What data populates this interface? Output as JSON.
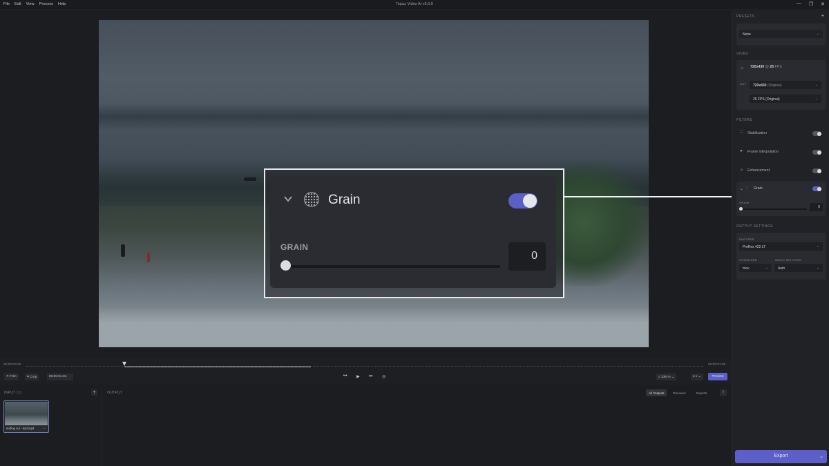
{
  "menu": [
    "File",
    "Edit",
    "View",
    "Process",
    "Help"
  ],
  "app_title": "Topaz Video AI  v3.0.0",
  "window_controls": {
    "minimize": "—",
    "maximize": "❐",
    "close": "✕"
  },
  "zoom_callout": {
    "title": "Grain",
    "enabled": true,
    "param_label": "GRAIN",
    "value": "0"
  },
  "timeline": {
    "start_time": "00:00:00:00",
    "end_time": "00:00:07:06",
    "trim_label": "Trim",
    "crop_label": "Crop",
    "current_time": "00:00:01:01",
    "zoom_value": "236 %",
    "speed_value": "2 x",
    "preview_label": "Preview"
  },
  "input_pane": {
    "title": "INPUT (1)",
    "add_label": "+",
    "files": [
      {
        "name": "surfing cut - dad.mp4",
        "more": "..."
      }
    ]
  },
  "output_pane": {
    "title": "OUTPUT",
    "tabs": [
      "All Outputs",
      "Previews",
      "Exports"
    ],
    "active_tab": "All Outputs"
  },
  "sidebar": {
    "presets": {
      "title": "PRESETS",
      "add_label": "+",
      "value": "None"
    },
    "video": {
      "title": "VIDEO",
      "in_label": "IN",
      "in_resolution": "720x430",
      "in_at": "@",
      "in_fps": "25",
      "in_fps_unit": "FPS",
      "out_label": "OUT",
      "out_resolution": "720x430",
      "out_resolution_note": "(Original)",
      "out_fps": "25 FPS (Original)"
    },
    "filters": {
      "title": "FILTERS",
      "items": [
        {
          "label": "Stabilization",
          "enabled": false
        },
        {
          "label": "Frame Interpolation",
          "enabled": false
        },
        {
          "label": "Enhancement",
          "enabled": false
        },
        {
          "label": "Grain",
          "enabled": true
        }
      ],
      "grain_param_label": "GRAIN",
      "grain_value": "0"
    },
    "output_settings": {
      "title": "OUTPUT SETTINGS",
      "encoder_label": "ENCODER",
      "encoder_value": "ProRes 422 LT",
      "container_label": "CONTAINER",
      "container_value": "mov",
      "audio_label": "AUDIO SETTINGS",
      "audio_value": "Auto"
    },
    "export_label": "Export"
  },
  "colors": {
    "accent": "#5b5fc7",
    "background": "#1c1d21",
    "panel": "#2a2b30"
  }
}
